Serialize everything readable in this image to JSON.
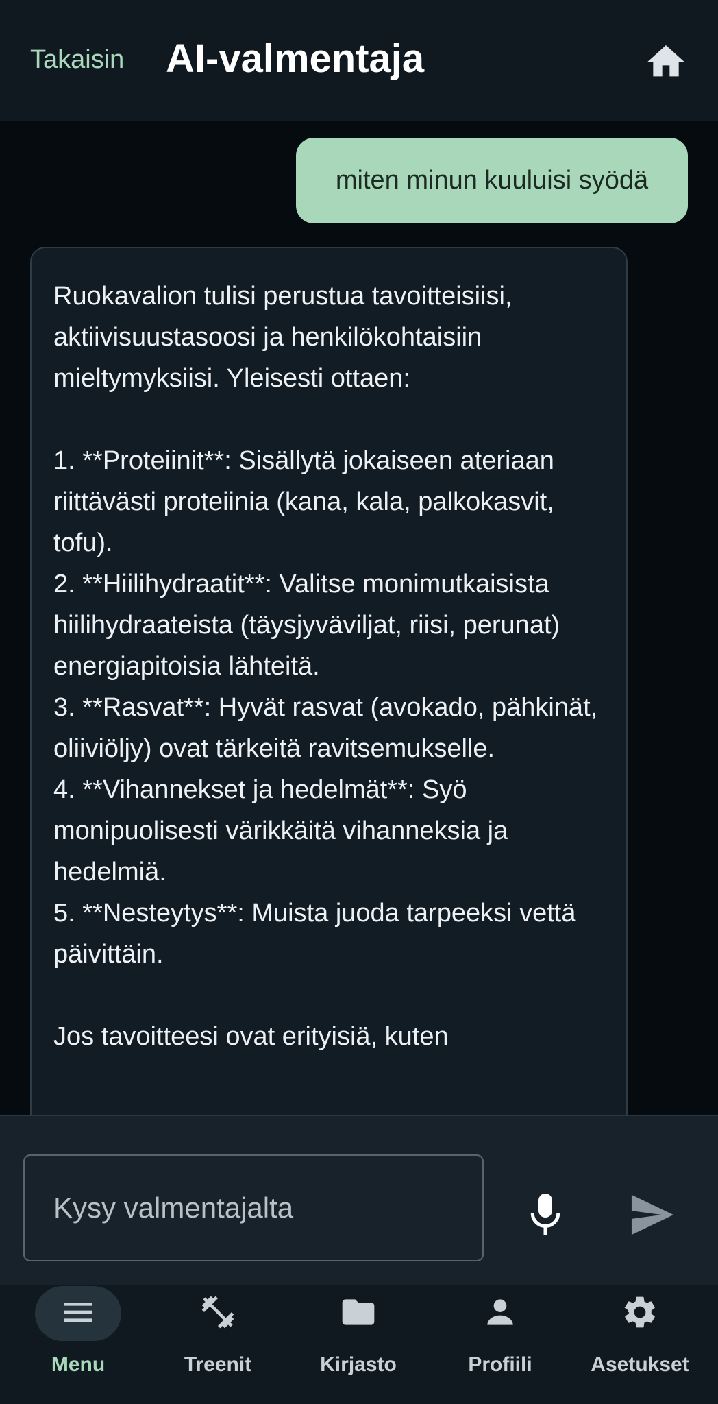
{
  "header": {
    "back_label": "Takaisin",
    "title": "AI-valmentaja",
    "home_icon": "home-icon"
  },
  "chat": {
    "user_message": "miten minun kuuluisi syödä",
    "ai_message": "Ruokavalion tulisi perustua tavoitteisiisi, aktiivisuustasoosi ja henkilökohtaisiin mieltymyksiisi. Yleisesti ottaen:\n\n1. **Proteiinit**: Sisällytä jokaiseen ateriaan riittävästi proteiinia (kana, kala, palkokasvit, tofu).\n2. **Hiilihydraatit**: Valitse monimutkaisista hiilihydraateista (täysjyväviljat, riisi, perunat) energiapitoisia lähteitä.\n3. **Rasvat**: Hyvät rasvat (avokado, pähkinät, oliiviöljy) ovat tärkeitä ravitsemukselle.\n4. **Vihannekset ja hedelmät**: Syö monipuolisesti värikkäitä vihanneksia ja hedelmiä.\n5. **Nesteytys**: Muista juoda tarpeeksi vettä päivittäin.\n\nJos tavoitteesi ovat erityisiä, kuten"
  },
  "composer": {
    "placeholder": "Kysy valmentajalta",
    "value": "",
    "mic_icon": "microphone-icon",
    "send_icon": "send-icon"
  },
  "nav": {
    "items": [
      {
        "label": "Menu",
        "icon": "menu-icon",
        "active": true
      },
      {
        "label": "Treenit",
        "icon": "dumbbell-icon",
        "active": false
      },
      {
        "label": "Kirjasto",
        "icon": "folder-icon",
        "active": false
      },
      {
        "label": "Profiili",
        "icon": "person-icon",
        "active": false
      },
      {
        "label": "Asetukset",
        "icon": "gear-icon",
        "active": false
      }
    ]
  },
  "colors": {
    "accent": "#a8d8b9",
    "background": "#060b0f",
    "header": "#101820",
    "ai_bubble": "#121c25"
  }
}
